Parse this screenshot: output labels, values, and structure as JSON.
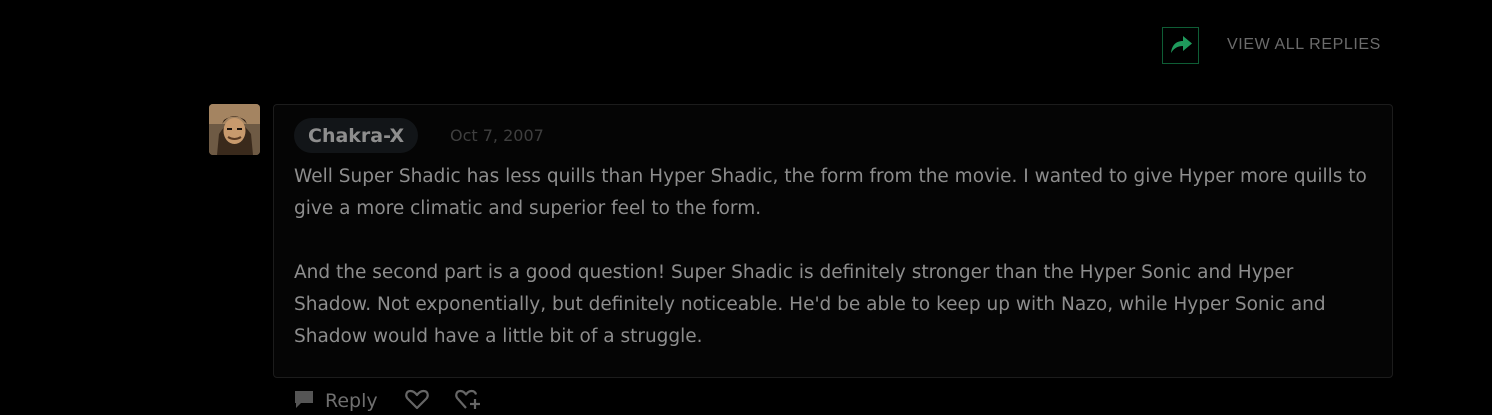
{
  "header": {
    "share_icon": "share-forward-icon",
    "view_all_replies_label": "VIEW ALL REPLIES"
  },
  "comment": {
    "avatar_icon": "user-avatar",
    "username": "Chakra-X",
    "date": "Oct 7, 2007",
    "paragraphs": [
      "Well Super Shadic has less quills than Hyper Shadic, the form from the movie. I wanted to give Hyper more quills to give a more climatic and superior feel to the form.",
      "And the second part is a good question! Super Shadic is definitely stronger than the Hyper Sonic and Hyper Shadow. Not exponentially, but definitely noticeable. He'd be able to keep up with Nazo, while Hyper Sonic and Shadow would have a little bit of a struggle."
    ]
  },
  "actions": {
    "reply_icon": "speech-bubble-icon",
    "reply_label": "Reply",
    "like_icon": "heart-icon",
    "favorite_icon": "heart-plus-icon"
  },
  "colors": {
    "background": "#000000",
    "share_border": "#0e5d35",
    "share_arrow": "#1f9a5c",
    "card_border": "#1c1c1c"
  }
}
